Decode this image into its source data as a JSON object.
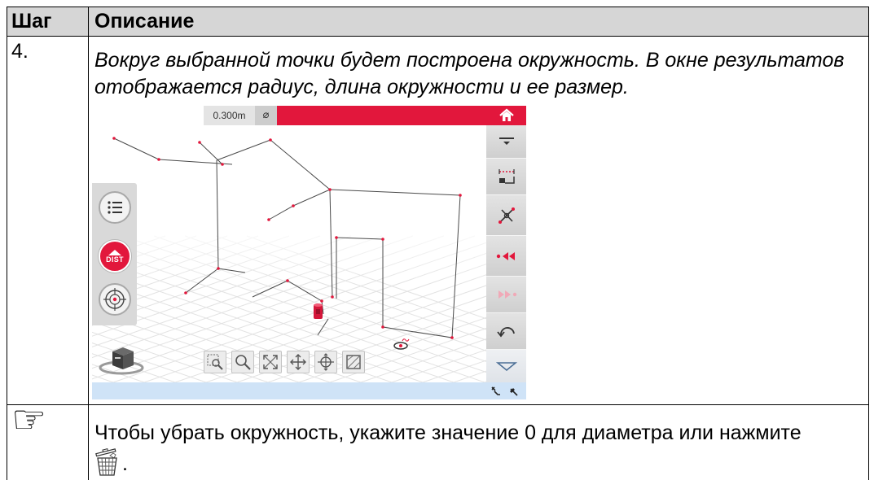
{
  "table": {
    "header": {
      "step": "Шаг",
      "description": "Описание"
    },
    "rows": [
      {
        "step": "4.",
        "description": "Вокруг выбранной точки будет построена окружность. В окне результатов отображается радиус, длина окружности и ее размер.",
        "figure": {
          "value_field": "0.300m",
          "diameter_symbol": "⌀",
          "dist_button": "DIST",
          "top_bar_icons": [
            "home-icon"
          ],
          "right_toolbar_icons": [
            "level-down-icon",
            "measure-icon",
            "intersect-icon",
            "previous-point-icon",
            "next-point-icon",
            "undo-icon",
            "dropdown-icon"
          ],
          "left_panel_icons": [
            "list-icon",
            "dist-icon",
            "target-icon"
          ],
          "bottom_toolbar_icons": [
            "zoom-window-icon",
            "zoom-icon",
            "zoom-extents-icon",
            "pan-icon",
            "orbit-icon",
            "view-box-icon"
          ],
          "status_bar_icons": [
            "connection-icon",
            "link-icon"
          ]
        }
      },
      {
        "step_icon": "pointing-hand-icon",
        "description": "Чтобы убрать окружность, укажите значение 0 для диаметра или нажмите",
        "inline_icon": "trash-icon",
        "after_icon": "."
      }
    ]
  },
  "colors": {
    "header_background": "#d6d6d6",
    "accent_red": "#e2173c",
    "toolbar_gray": "#d8d8d8",
    "status_bar_blue": "#cfe3f7"
  }
}
